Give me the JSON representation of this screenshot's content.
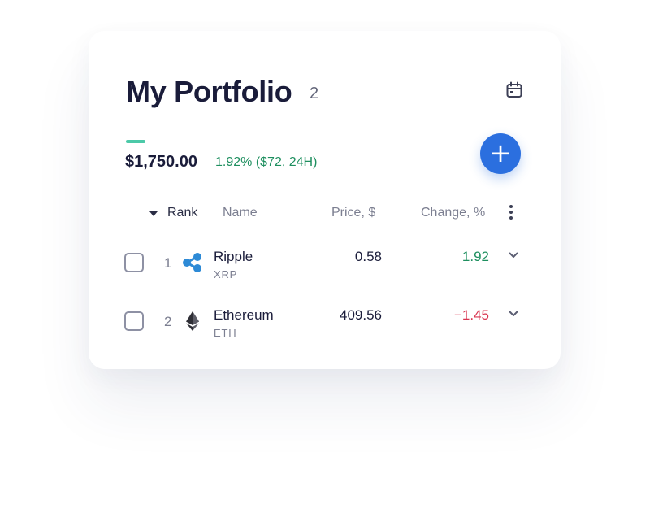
{
  "portfolio": {
    "title": "My Portfolio",
    "count": "2",
    "total": "$1,750.00",
    "delta": "1.92% ($72, 24H)",
    "add_label": "+"
  },
  "table": {
    "headers": {
      "rank": "Rank",
      "name": "Name",
      "price": "Price, $",
      "change": "Change, %"
    },
    "rows": [
      {
        "rank": "1",
        "name": "Ripple",
        "symbol": "XRP",
        "price": "0.58",
        "change": "1.92",
        "direction": "up",
        "icon": "ripple-icon"
      },
      {
        "rank": "2",
        "name": "Ethereum",
        "symbol": "ETH",
        "price": "409.56",
        "change": "−1.45",
        "direction": "down",
        "icon": "ethereum-icon"
      }
    ]
  },
  "icons": [
    "calendar-icon",
    "plus-icon",
    "sort-caret-icon",
    "more-vertical-icon",
    "chevron-down-icon",
    "ripple-icon",
    "ethereum-icon"
  ],
  "colors": {
    "accent": "#4cc9a8",
    "primary_button": "#2b6fdf",
    "positive": "#1e8f5f",
    "negative": "#d8344f",
    "text_primary": "#1a1c3a",
    "text_secondary": "#7c7f91"
  }
}
